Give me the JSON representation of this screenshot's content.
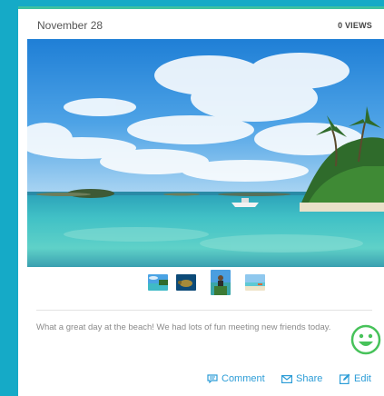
{
  "post": {
    "date": "November 28",
    "views": "0 VIEWS",
    "caption": "What a great day at the beach!  We had lots of fun meeting new friends today.",
    "mood_icon": "smiley-icon"
  },
  "gallery": {
    "thumbnails": [
      "beach-island",
      "sea-turtle",
      "person-on-beach",
      "beach-shore"
    ],
    "selected_index": 2
  },
  "actions": {
    "comment": "Comment",
    "share": "Share",
    "edit": "Edit"
  },
  "colors": {
    "background": "#15aac7",
    "accent": "#3ec1a1",
    "link": "#2d9dd7",
    "smiley": "#47c25a"
  }
}
